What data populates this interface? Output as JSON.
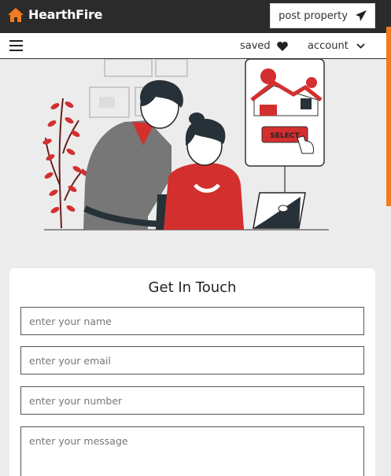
{
  "brand": {
    "name": "HearthFire",
    "accent": "#f47a1f"
  },
  "header": {
    "post_label": "post property",
    "post_icon": "paper-plane-icon"
  },
  "nav": {
    "menu_icon": "hamburger-icon",
    "saved_label": "saved",
    "saved_icon": "heart-icon",
    "account_label": "account",
    "account_icon": "chevron-down-icon"
  },
  "hero": {
    "select_label": "SELECT"
  },
  "form": {
    "title": "Get In Touch",
    "name_placeholder": "enter your name",
    "email_placeholder": "enter your email",
    "number_placeholder": "enter your number",
    "message_placeholder": "enter your message"
  }
}
